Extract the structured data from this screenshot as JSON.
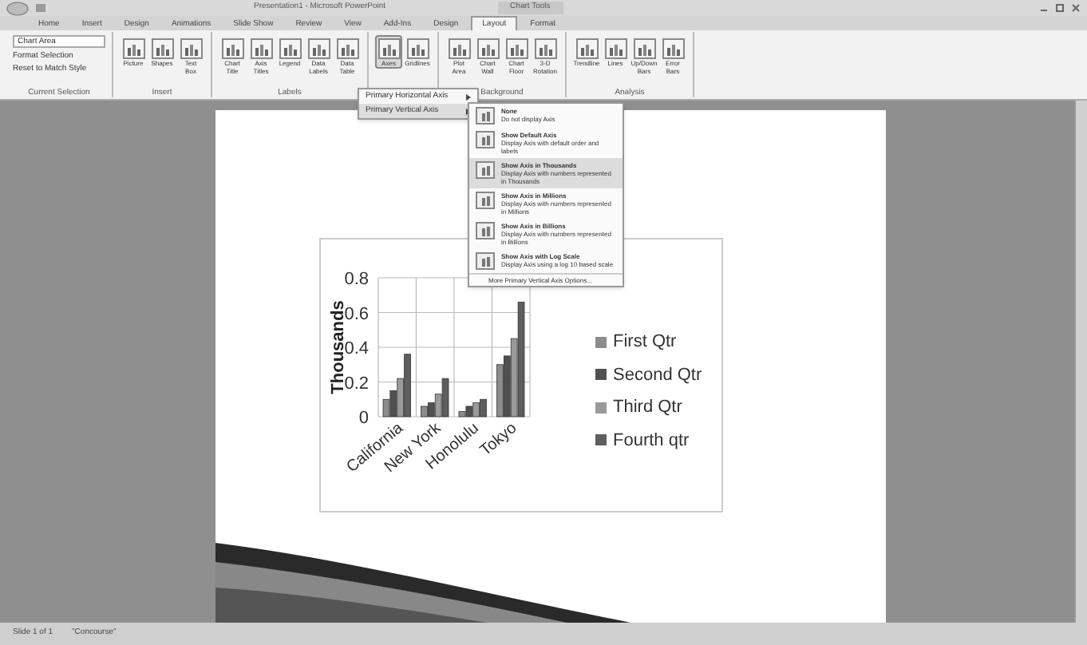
{
  "window": {
    "title": "Presentation1 - Microsoft PowerPoint",
    "context_tab": "Chart Tools"
  },
  "tabs": [
    {
      "label": "Home",
      "selected": false
    },
    {
      "label": "Insert",
      "selected": false
    },
    {
      "label": "Design",
      "selected": false
    },
    {
      "label": "Animations",
      "selected": false
    },
    {
      "label": "Slide Show",
      "selected": false
    },
    {
      "label": "Review",
      "selected": false
    },
    {
      "label": "View",
      "selected": false
    },
    {
      "label": "Add-Ins",
      "selected": false
    },
    {
      "label": "Design",
      "selected": false
    },
    {
      "label": "Layout",
      "selected": true
    },
    {
      "label": "Format",
      "selected": false
    }
  ],
  "ribbon": [
    {
      "label": "Current Selection",
      "kind": "list",
      "dropdown": "Chart Area",
      "items": [
        "Format Selection",
        "Reset to Match Style"
      ]
    },
    {
      "label": "Insert",
      "kind": "buttons",
      "buttons": [
        {
          "label": "Picture",
          "selected": false
        },
        {
          "label": "Shapes",
          "selected": false
        },
        {
          "label": "Text Box",
          "selected": false
        }
      ]
    },
    {
      "label": "Labels",
      "kind": "buttons",
      "buttons": [
        {
          "label": "Chart Title",
          "selected": false
        },
        {
          "label": "Axis Titles",
          "selected": false
        },
        {
          "label": "Legend",
          "selected": false
        },
        {
          "label": "Data Labels",
          "selected": false
        },
        {
          "label": "Data Table",
          "selected": false
        }
      ]
    },
    {
      "kind": "buttons",
      "buttons": [
        {
          "label": "Axes",
          "selected": true
        },
        {
          "label": "Gridlines",
          "selected": false
        }
      ]
    },
    {
      "label": "Background",
      "kind": "buttons",
      "buttons": [
        {
          "label": "Plot Area",
          "selected": false
        },
        {
          "label": "Chart Wall",
          "selected": false
        },
        {
          "label": "Chart Floor",
          "selected": false
        },
        {
          "label": "3-D Rotation",
          "selected": false
        }
      ]
    },
    {
      "label": "Analysis",
      "kind": "buttons",
      "buttons": [
        {
          "label": "Trendline",
          "selected": false
        },
        {
          "label": "Lines",
          "selected": false
        },
        {
          "label": "Up/Down Bars",
          "selected": false
        },
        {
          "label": "Error Bars",
          "selected": false
        }
      ]
    }
  ],
  "axes_menu": [
    {
      "label": "Primary Horizontal Axis",
      "selected": false
    },
    {
      "label": "Primary Vertical Axis",
      "selected": true
    }
  ],
  "submenu": {
    "items": [
      {
        "title": "None",
        "desc": "Do not display Axis",
        "selected": false
      },
      {
        "title": "Show Default Axis",
        "desc": "Display Axis with default order and labels",
        "selected": false
      },
      {
        "title": "Show Axis in Thousands",
        "desc": "Display Axis with numbers represented in Thousands",
        "selected": true
      },
      {
        "title": "Show Axis in Millions",
        "desc": "Display Axis with numbers represented in Millions",
        "selected": false
      },
      {
        "title": "Show Axis in Billions",
        "desc": "Display Axis with numbers represented in Billions",
        "selected": false
      },
      {
        "title": "Show Axis with Log Scale",
        "desc": "Display Axis using a log 10 based scale",
        "selected": false
      }
    ],
    "more": "More Primary Vertical Axis Options..."
  },
  "chart": {
    "chart_data": {
      "type": "bar",
      "grid": true,
      "legend": true,
      "ylabel": "Thousands",
      "categories": [
        "California",
        "New York",
        "Honolulu",
        "Tokyo"
      ],
      "yticks": [
        0,
        0.2,
        0.4,
        0.6,
        0.8
      ],
      "ylim": [
        0,
        0.8
      ],
      "series": [
        {
          "name": "First Qtr",
          "color": "#8c8c8c",
          "values": [
            0.1,
            0.06,
            0.03,
            0.3
          ]
        },
        {
          "name": "Second Qtr",
          "color": "#505050",
          "values": [
            0.15,
            0.08,
            0.06,
            0.35
          ]
        },
        {
          "name": "Third Qtr",
          "color": "#9a9a9a",
          "values": [
            0.22,
            0.13,
            0.08,
            0.45
          ]
        },
        {
          "name": "Fourth qtr",
          "color": "#5e5e5e",
          "values": [
            0.36,
            0.22,
            0.1,
            0.66
          ]
        }
      ]
    }
  },
  "status_bar": {
    "slide": "Slide 1 of 1",
    "theme": "\"Concourse\""
  }
}
